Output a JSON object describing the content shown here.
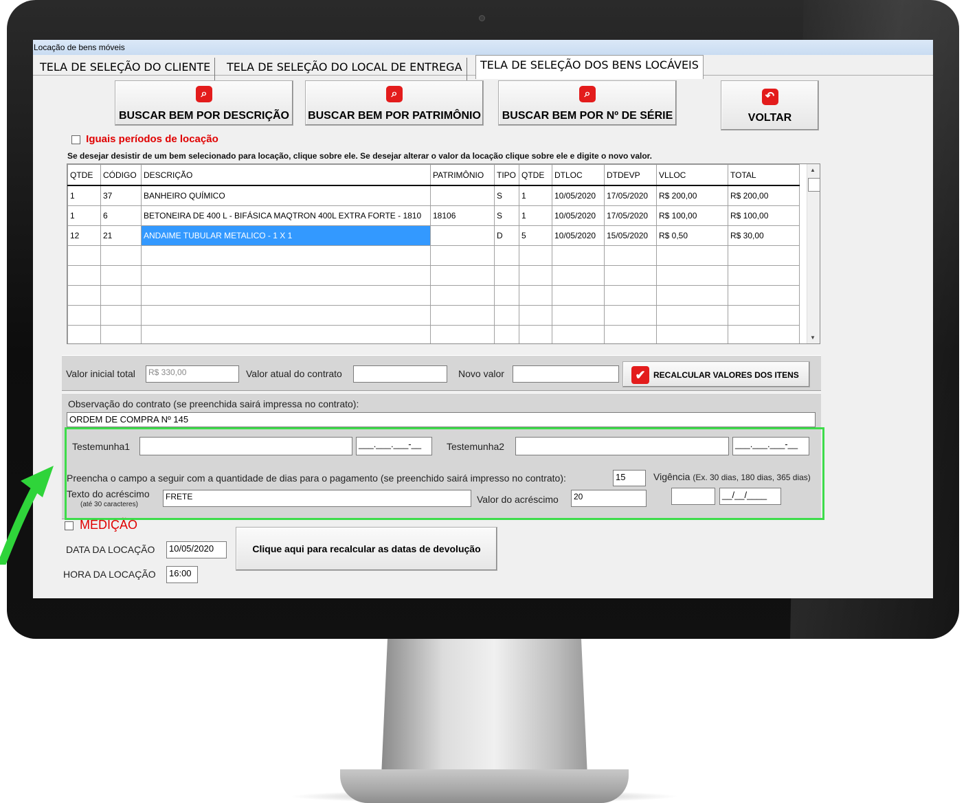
{
  "window": {
    "title": "Locação de bens móveis"
  },
  "tabs": [
    {
      "label": "TELA DE SELEÇÃO DO CLIENTE"
    },
    {
      "label": "TELA DE SELEÇÃO DO LOCAL DE ENTREGA"
    },
    {
      "label": "TELA DE SELEÇÃO DOS BENS LOCÁVEIS",
      "active": true
    }
  ],
  "toolbar": {
    "buscar_descricao": "BUSCAR BEM POR DESCRIÇÃO",
    "buscar_patrimonio": "BUSCAR BEM POR PATRIMÔNIO",
    "buscar_serie": "BUSCAR BEM POR Nº DE SÉRIE",
    "voltar": "VOLTAR"
  },
  "iguais_periodos": {
    "label": "Iguais períodos de locação",
    "checked": false
  },
  "instructions": "Se desejar desistir de um bem selecionado para locação, clique sobre ele.  Se desejar alterar o valor da locação clique sobre ele e digite o novo valor.",
  "grid": {
    "columns": [
      "QTDE",
      "CÓDIGO",
      "DESCRIÇÃO",
      "PATRIMÔNIO",
      "TIPO",
      "QTDE",
      "DTLOC",
      "DTDEVP",
      "VLLOC",
      "TOTAL"
    ],
    "rows": [
      [
        "1",
        "37",
        "BANHEIRO QUÍMICO",
        "",
        "S",
        "1",
        "10/05/2020",
        "17/05/2020",
        "R$ 200,00",
        "R$ 200,00"
      ],
      [
        "1",
        "6",
        "BETONEIRA DE 400 L - BIFÁSICA MAQTRON 400L EXTRA FORTE - 1810",
        "18106",
        "S",
        "1",
        "10/05/2020",
        "17/05/2020",
        "R$ 100,00",
        "R$ 100,00"
      ],
      [
        "12",
        "21",
        "ANDAIME TUBULAR METALICO - 1 X 1",
        "",
        "D",
        "5",
        "10/05/2020",
        "15/05/2020",
        "R$ 0,50",
        "R$ 30,00"
      ]
    ],
    "selected_row": 2
  },
  "valores": {
    "valor_inicial_label": "Valor inicial total",
    "valor_inicial": "R$ 330,00",
    "valor_atual_label": "Valor atual do contrato",
    "valor_atual": "",
    "novo_valor_label": "Novo valor",
    "novo_valor": "",
    "recalcular": "RECALCULAR VALORES DOS ITENS"
  },
  "observacao": {
    "label": "Observação do contrato (se preenchida sairá impressa no contrato):",
    "value": "ORDEM DE COMPRA Nº 145"
  },
  "testemunhas": {
    "t1_label": "Testemunha1",
    "t1_value": "",
    "t1_cpf": "___.___.___-__",
    "t2_label": "Testemunha2",
    "t2_value": "",
    "t2_cpf": "___.___.___-__"
  },
  "pagamento": {
    "label": "Preencha o campo a seguir com a quantidade de dias para o pagamento (se preenchido sairá impresso no contrato):",
    "dias": "15",
    "vigencia_label": "Vigência",
    "vigencia_hint": "(Ex. 30 dias, 180 dias, 365 dias)",
    "vigencia_dias": "",
    "vigencia_data": "__/__/____",
    "texto_acrescimo_label": "Texto do acréscimo",
    "texto_acrescimo_hint": "(até 30 caracteres)",
    "texto_acrescimo": "FRETE",
    "valor_acrescimo_label": "Valor do acréscimo",
    "valor_acrescimo": "20"
  },
  "medicao": {
    "label": "MEDIÇÃO",
    "checked": false
  },
  "locacao": {
    "data_label": "DATA DA LOCAÇÃO",
    "data": "10/05/2020",
    "hora_label": "HORA DA LOCAÇÃO",
    "hora": "16:00",
    "recalcular_datas": "Clique aqui para recalcular as datas de devolução"
  },
  "colors": {
    "accent_red": "#e31c1c",
    "highlight_green": "#3ddc4a",
    "selection_blue": "#3399ff"
  }
}
